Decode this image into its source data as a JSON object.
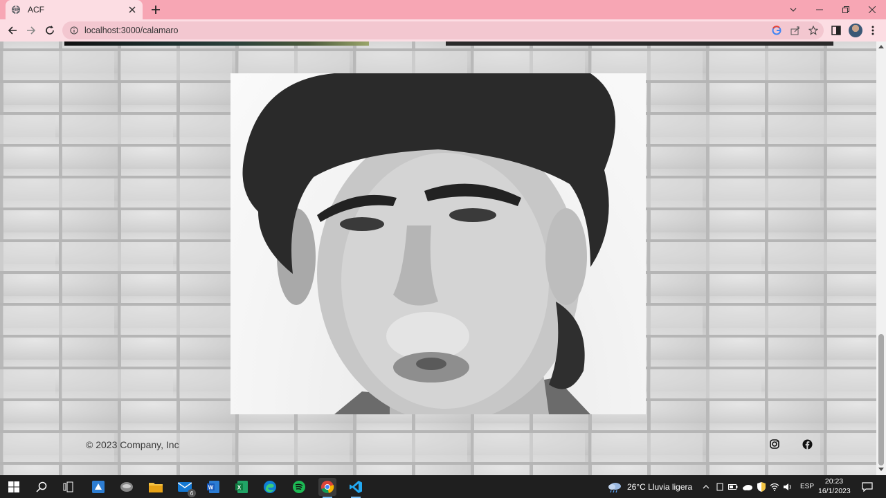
{
  "browser": {
    "tab_title": "ACF",
    "url": "localhost:3000/calamaro"
  },
  "page": {
    "footer_copyright": "© 2023 Company, Inc",
    "photo_alt": "",
    "social": [
      "instagram-icon",
      "facebook-icon"
    ]
  },
  "taskbar": {
    "mail_badge": "6",
    "weather": "26°C  Lluvia ligera",
    "language": "ESP",
    "time": "20:23",
    "date": "16/1/2023"
  },
  "colors": {
    "tab_strip": "#f7a6b4",
    "toolbar": "#fcdde3",
    "taskbar": "#1f1f1f"
  }
}
